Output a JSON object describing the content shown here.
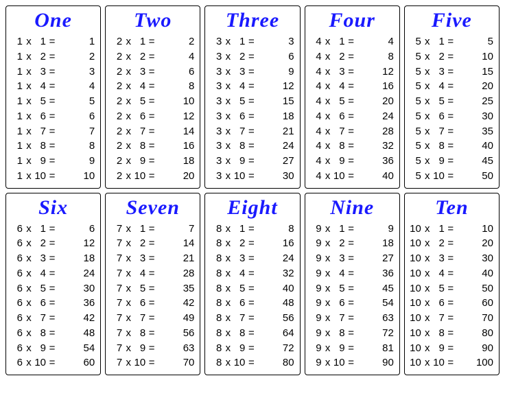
{
  "tables": [
    {
      "title": "One",
      "n": 1,
      "rows": [
        [
          1,
          1,
          1
        ],
        [
          1,
          2,
          2
        ],
        [
          1,
          3,
          3
        ],
        [
          1,
          4,
          4
        ],
        [
          1,
          5,
          5
        ],
        [
          1,
          6,
          6
        ],
        [
          1,
          7,
          7
        ],
        [
          1,
          8,
          8
        ],
        [
          1,
          9,
          9
        ],
        [
          1,
          10,
          10
        ]
      ]
    },
    {
      "title": "Two",
      "n": 2,
      "rows": [
        [
          2,
          1,
          2
        ],
        [
          2,
          2,
          4
        ],
        [
          2,
          3,
          6
        ],
        [
          2,
          4,
          8
        ],
        [
          2,
          5,
          10
        ],
        [
          2,
          6,
          12
        ],
        [
          2,
          7,
          14
        ],
        [
          2,
          8,
          16
        ],
        [
          2,
          9,
          18
        ],
        [
          2,
          10,
          20
        ]
      ]
    },
    {
      "title": "Three",
      "n": 3,
      "rows": [
        [
          3,
          1,
          3
        ],
        [
          3,
          2,
          6
        ],
        [
          3,
          3,
          9
        ],
        [
          3,
          4,
          12
        ],
        [
          3,
          5,
          15
        ],
        [
          3,
          6,
          18
        ],
        [
          3,
          7,
          21
        ],
        [
          3,
          8,
          24
        ],
        [
          3,
          9,
          27
        ],
        [
          3,
          10,
          30
        ]
      ]
    },
    {
      "title": "Four",
      "n": 4,
      "rows": [
        [
          4,
          1,
          4
        ],
        [
          4,
          2,
          8
        ],
        [
          4,
          3,
          12
        ],
        [
          4,
          4,
          16
        ],
        [
          4,
          5,
          20
        ],
        [
          4,
          6,
          24
        ],
        [
          4,
          7,
          28
        ],
        [
          4,
          8,
          32
        ],
        [
          4,
          9,
          36
        ],
        [
          4,
          10,
          40
        ]
      ]
    },
    {
      "title": "Five",
      "n": 5,
      "rows": [
        [
          5,
          1,
          5
        ],
        [
          5,
          2,
          10
        ],
        [
          5,
          3,
          15
        ],
        [
          5,
          4,
          20
        ],
        [
          5,
          5,
          25
        ],
        [
          5,
          6,
          30
        ],
        [
          5,
          7,
          35
        ],
        [
          5,
          8,
          40
        ],
        [
          5,
          9,
          45
        ],
        [
          5,
          10,
          50
        ]
      ]
    },
    {
      "title": "Six",
      "n": 6,
      "rows": [
        [
          6,
          1,
          6
        ],
        [
          6,
          2,
          12
        ],
        [
          6,
          3,
          18
        ],
        [
          6,
          4,
          24
        ],
        [
          6,
          5,
          30
        ],
        [
          6,
          6,
          36
        ],
        [
          6,
          7,
          42
        ],
        [
          6,
          8,
          48
        ],
        [
          6,
          9,
          54
        ],
        [
          6,
          10,
          60
        ]
      ]
    },
    {
      "title": "Seven",
      "n": 7,
      "rows": [
        [
          7,
          1,
          7
        ],
        [
          7,
          2,
          14
        ],
        [
          7,
          3,
          21
        ],
        [
          7,
          4,
          28
        ],
        [
          7,
          5,
          35
        ],
        [
          7,
          6,
          42
        ],
        [
          7,
          7,
          49
        ],
        [
          7,
          8,
          56
        ],
        [
          7,
          9,
          63
        ],
        [
          7,
          10,
          70
        ]
      ]
    },
    {
      "title": "Eight",
      "n": 8,
      "rows": [
        [
          8,
          1,
          8
        ],
        [
          8,
          2,
          16
        ],
        [
          8,
          3,
          24
        ],
        [
          8,
          4,
          32
        ],
        [
          8,
          5,
          40
        ],
        [
          8,
          6,
          48
        ],
        [
          8,
          7,
          56
        ],
        [
          8,
          8,
          64
        ],
        [
          8,
          9,
          72
        ],
        [
          8,
          10,
          80
        ]
      ]
    },
    {
      "title": "Nine",
      "n": 9,
      "rows": [
        [
          9,
          1,
          9
        ],
        [
          9,
          2,
          18
        ],
        [
          9,
          3,
          27
        ],
        [
          9,
          4,
          36
        ],
        [
          9,
          5,
          45
        ],
        [
          9,
          6,
          54
        ],
        [
          9,
          7,
          63
        ],
        [
          9,
          8,
          72
        ],
        [
          9,
          9,
          81
        ],
        [
          9,
          10,
          90
        ]
      ]
    },
    {
      "title": "Ten",
      "n": 10,
      "rows": [
        [
          10,
          1,
          10
        ],
        [
          10,
          2,
          20
        ],
        [
          10,
          3,
          30
        ],
        [
          10,
          4,
          40
        ],
        [
          10,
          5,
          50
        ],
        [
          10,
          6,
          60
        ],
        [
          10,
          7,
          70
        ],
        [
          10,
          8,
          80
        ],
        [
          10,
          9,
          90
        ],
        [
          10,
          10,
          100
        ]
      ]
    }
  ],
  "symbols": {
    "times": "x",
    "equals": "="
  }
}
